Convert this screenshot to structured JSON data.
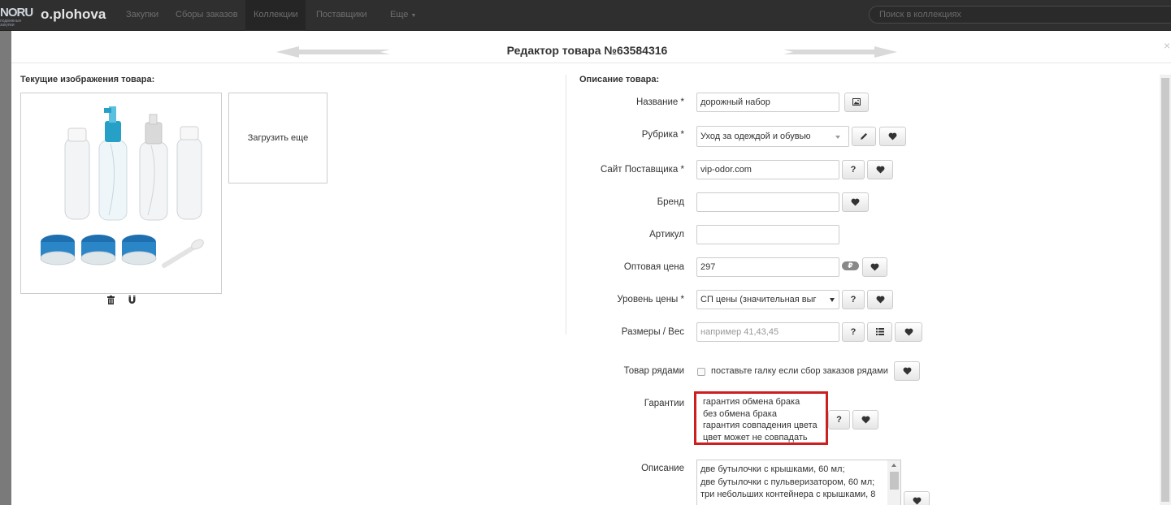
{
  "nav": {
    "logo_text": "NORU",
    "logo_sub": "подвижные закупки",
    "user": "o.plohova",
    "items": [
      "Закупки",
      "Сборы заказов",
      "Коллекции",
      "Поставщики",
      "Еще"
    ],
    "search_placeholder": "Поиск в коллекциях"
  },
  "modal": {
    "title": "Редактор товара №63584316",
    "close": "×"
  },
  "left": {
    "images_label": "Текущие изображения товара:",
    "upload_label": "Загрузить еще"
  },
  "form": {
    "section_label": "Описание товара:",
    "name_label": "Название *",
    "name_value": "дорожный набор",
    "rubric_label": "Рубрика *",
    "rubric_value": "Уход за одеждой и обувью",
    "site_label": "Сайт Поставщика *",
    "site_value": "vip-odor.com",
    "brand_label": "Бренд",
    "brand_value": "",
    "article_label": "Артикул",
    "article_value": "",
    "price_label": "Оптовая цена",
    "price_value": "297",
    "currency_badge": "₽",
    "price_level_label": "Уровень цены *",
    "price_level_value": "СП цены (значительная выг",
    "sizes_label": "Размеры / Вес",
    "sizes_placeholder": "например 41,43,45",
    "rows_label": "Товар рядами",
    "rows_checkbox_text": "поставьте галку если сбор заказов рядами",
    "guarantee_label": "Гарантии",
    "guarantee_options": [
      "гарантия обмена брака",
      "без обмена брака",
      "гарантия совпадения цвета",
      "цвет может не совпадать"
    ],
    "description_label": "Описание",
    "description_lines": [
      "две бутылочки с крышками, 60 мл;",
      "две бутылочки с пульверизатором, 60 мл;",
      "три небольших контейнера с крышками, 8"
    ],
    "help_button": "?"
  },
  "colors": {
    "highlight_border": "#cc1f1f",
    "navbar_bg": "#2f2f2f",
    "overlay_bg": "#7a7a7a"
  }
}
